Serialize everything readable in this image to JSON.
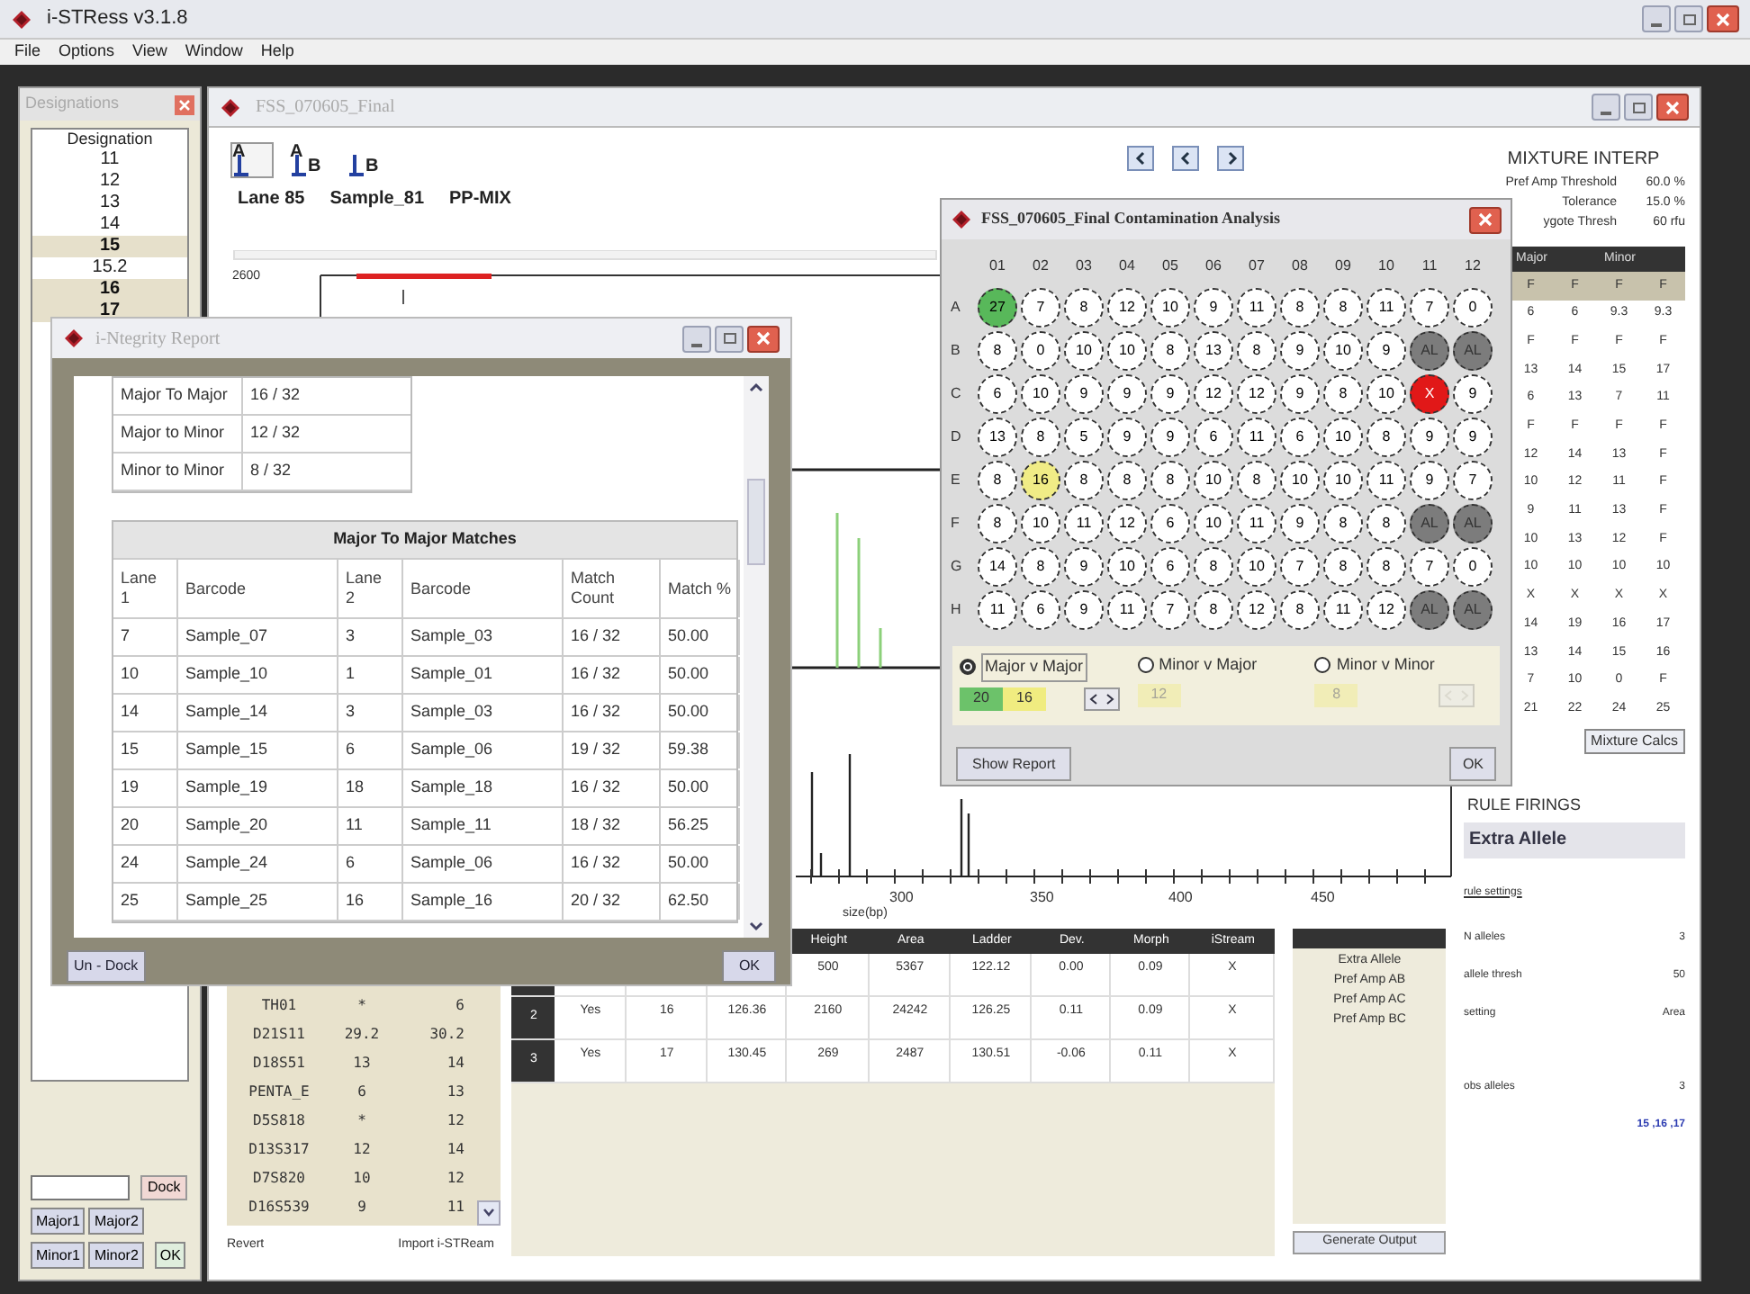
{
  "window": {
    "title": "i-STRess v3.1.8"
  },
  "menu": [
    "File",
    "Options",
    "View",
    "Window",
    "Help"
  ],
  "designations": {
    "title": "Designations",
    "header": "Designation",
    "items": [
      {
        "label": "11",
        "selected": false
      },
      {
        "label": "12",
        "selected": false
      },
      {
        "label": "13",
        "selected": false
      },
      {
        "label": "14",
        "selected": false
      },
      {
        "label": "15",
        "selected": true
      },
      {
        "label": "15.2",
        "selected": false
      },
      {
        "label": "16",
        "selected": true
      },
      {
        "label": "17",
        "selected": true
      }
    ],
    "dock_button": "Dock",
    "buttons": [
      [
        "Major1",
        "Major2"
      ],
      [
        "Minor1",
        "Minor2",
        "OK"
      ]
    ]
  },
  "main": {
    "title": "FSS_070605_Final",
    "view_buttons": [
      {
        "letters": [
          "A"
        ],
        "selected": true
      },
      {
        "letters": [
          "A",
          "B"
        ],
        "selected": false
      },
      {
        "letters": [
          "B"
        ],
        "selected": false
      }
    ],
    "nav_buttons": [
      {
        "kind": "prev"
      },
      {
        "kind": "prev"
      },
      {
        "kind": "next"
      }
    ],
    "lane": "Lane 85",
    "sample": "Sample_81",
    "kit": "PP-MIX",
    "chart": {
      "y_labels": [
        "2600"
      ],
      "x_labels": [
        "300",
        "350",
        "400",
        "450"
      ],
      "x_title": "size(bp)"
    },
    "loci": [
      {
        "name": "TH01",
        "a": "*",
        "b": "6"
      },
      {
        "name": "D21S11",
        "a": "29.2",
        "b": "30.2"
      },
      {
        "name": "D18S51",
        "a": "13",
        "b": "14"
      },
      {
        "name": "PENTA_E",
        "a": "6",
        "b": "13"
      },
      {
        "name": "D5S818",
        "a": "*",
        "b": "12"
      },
      {
        "name": "D13S317",
        "a": "12",
        "b": "14"
      },
      {
        "name": "D7S820",
        "a": "10",
        "b": "12"
      },
      {
        "name": "D16S539",
        "a": "9",
        "b": "11"
      }
    ],
    "revert": "Revert",
    "import": "Import i-STReam",
    "peak_columns": [
      "Height",
      "Area",
      "Ladder",
      "Dev.",
      "Morph",
      "iStream"
    ],
    "peak_rows": [
      {
        "cells": [
          "500",
          "5367",
          "122.12",
          "0.00",
          "0.09",
          "X"
        ]
      },
      {
        "label": "2",
        "cells": [
          "Yes",
          "16",
          "126.36",
          "2160",
          "24242",
          "126.25",
          "0.11",
          "0.09",
          "X"
        ]
      },
      {
        "label": "3",
        "cells": [
          "Yes",
          "17",
          "130.45",
          "269",
          "2487",
          "130.51",
          "-0.06",
          "0.11",
          "X"
        ]
      }
    ],
    "rules": [
      "Extra Allele",
      "Pref Amp AB",
      "Pref Amp AC",
      "Pref Amp BC"
    ],
    "generate_button": "Generate Output",
    "mixture": {
      "title": "MIXTURE INTERP",
      "settings": [
        {
          "label": "Pref Amp Threshold",
          "value": "60.0 %"
        },
        {
          "label": "Tolerance",
          "value": "15.0 %"
        },
        {
          "label": "ygote Thresh",
          "value": "60 rfu"
        }
      ],
      "groups": [
        "Major",
        "Minor"
      ],
      "rows": [
        [
          "F",
          "F",
          "F",
          "F"
        ],
        [
          "6",
          "6",
          "9.3",
          "9.3"
        ],
        [
          "F",
          "F",
          "F",
          "F"
        ],
        [
          "13",
          "14",
          "15",
          "17"
        ],
        [
          "6",
          "13",
          "7",
          "11"
        ],
        [
          "F",
          "F",
          "F",
          "F"
        ],
        [
          "12",
          "14",
          "13",
          "F"
        ],
        [
          "10",
          "12",
          "11",
          "F"
        ],
        [
          "9",
          "11",
          "13",
          "F"
        ],
        [
          "10",
          "13",
          "12",
          "F"
        ],
        [
          "10",
          "10",
          "10",
          "10"
        ],
        [
          "X",
          "X",
          "X",
          "X"
        ],
        [
          "14",
          "19",
          "16",
          "17"
        ],
        [
          "13",
          "14",
          "15",
          "16"
        ],
        [
          "7",
          "10",
          "0",
          "F"
        ],
        [
          "21",
          "22",
          "24",
          "25"
        ]
      ],
      "calcs_button": "Mixture Calcs"
    },
    "rule_firings": {
      "title": "RULE FIRINGS",
      "rule": "Extra Allele",
      "settings_link": "rule settings",
      "params": [
        {
          "label": "N alleles",
          "value": "3"
        },
        {
          "label": "allele thresh",
          "value": "50"
        },
        {
          "label": "setting",
          "value": "Area"
        },
        {
          "label": "obs alleles",
          "value": "3"
        }
      ],
      "alleles": "15 ,16 ,17"
    }
  },
  "report": {
    "title": "i-Ntegrity Report",
    "summary": [
      {
        "label": "Major To Major",
        "value": "16 / 32"
      },
      {
        "label": "Major to Minor",
        "value": "12 / 32"
      },
      {
        "label": "Minor to Minor",
        "value": "8 / 32"
      }
    ],
    "table_title": "Major To Major Matches",
    "columns": [
      "Lane 1",
      "Barcode",
      "Lane 2",
      "Barcode",
      "Match Count",
      "Match %"
    ],
    "rows": [
      [
        "7",
        "Sample_07",
        "3",
        "Sample_03",
        "16 / 32",
        "50.00"
      ],
      [
        "10",
        "Sample_10",
        "1",
        "Sample_01",
        "16 / 32",
        "50.00"
      ],
      [
        "14",
        "Sample_14",
        "3",
        "Sample_03",
        "16 / 32",
        "50.00"
      ],
      [
        "15",
        "Sample_15",
        "6",
        "Sample_06",
        "19 / 32",
        "59.38"
      ],
      [
        "19",
        "Sample_19",
        "18",
        "Sample_18",
        "16 / 32",
        "50.00"
      ],
      [
        "20",
        "Sample_20",
        "11",
        "Sample_11",
        "18 / 32",
        "56.25"
      ],
      [
        "24",
        "Sample_24",
        "6",
        "Sample_06",
        "16 / 32",
        "50.00"
      ],
      [
        "25",
        "Sample_25",
        "16",
        "Sample_16",
        "20 / 32",
        "62.50"
      ]
    ],
    "undock_button": "Un - Dock",
    "ok_button": "OK"
  },
  "contamination": {
    "title": "FSS_070605_Final Contamination Analysis",
    "columns": [
      "01",
      "02",
      "03",
      "04",
      "05",
      "06",
      "07",
      "08",
      "09",
      "10",
      "11",
      "12"
    ],
    "rows": [
      {
        "label": "A",
        "wells": [
          {
            "text": "27",
            "kind": "major"
          },
          {
            "text": "7",
            "kind": "sample"
          },
          {
            "text": "8",
            "kind": "sample"
          },
          {
            "text": "12",
            "kind": "sample"
          },
          {
            "text": "10",
            "kind": "sample"
          },
          {
            "text": "9",
            "kind": "sample"
          },
          {
            "text": "11",
            "kind": "sample"
          },
          {
            "text": "8",
            "kind": "sample"
          },
          {
            "text": "8",
            "kind": "sample"
          },
          {
            "text": "11",
            "kind": "sample"
          },
          {
            "text": "7",
            "kind": "sample"
          },
          {
            "text": "0",
            "kind": "sample"
          }
        ]
      },
      {
        "label": "B",
        "wells": [
          {
            "text": "8",
            "kind": "sample"
          },
          {
            "text": "0",
            "kind": "sample"
          },
          {
            "text": "10",
            "kind": "sample"
          },
          {
            "text": "10",
            "kind": "sample"
          },
          {
            "text": "8",
            "kind": "sample"
          },
          {
            "text": "13",
            "kind": "sample"
          },
          {
            "text": "8",
            "kind": "sample"
          },
          {
            "text": "9",
            "kind": "sample"
          },
          {
            "text": "10",
            "kind": "sample"
          },
          {
            "text": "9",
            "kind": "sample"
          },
          {
            "text": "AL",
            "kind": "ladder"
          },
          {
            "text": "AL",
            "kind": "ladder"
          }
        ]
      },
      {
        "label": "C",
        "wells": [
          {
            "text": "6",
            "kind": "sample"
          },
          {
            "text": "10",
            "kind": "sample"
          },
          {
            "text": "9",
            "kind": "sample"
          },
          {
            "text": "9",
            "kind": "sample"
          },
          {
            "text": "9",
            "kind": "sample"
          },
          {
            "text": "12",
            "kind": "sample"
          },
          {
            "text": "12",
            "kind": "sample"
          },
          {
            "text": "9",
            "kind": "sample"
          },
          {
            "text": "8",
            "kind": "sample"
          },
          {
            "text": "10",
            "kind": "sample"
          },
          {
            "text": "X",
            "kind": "flagged"
          },
          {
            "text": "9",
            "kind": "sample"
          }
        ]
      },
      {
        "label": "D",
        "wells": [
          {
            "text": "13",
            "kind": "sample"
          },
          {
            "text": "8",
            "kind": "sample"
          },
          {
            "text": "5",
            "kind": "sample"
          },
          {
            "text": "9",
            "kind": "sample"
          },
          {
            "text": "9",
            "kind": "sample"
          },
          {
            "text": "6",
            "kind": "sample"
          },
          {
            "text": "11",
            "kind": "sample"
          },
          {
            "text": "6",
            "kind": "sample"
          },
          {
            "text": "10",
            "kind": "sample"
          },
          {
            "text": "8",
            "kind": "sample"
          },
          {
            "text": "9",
            "kind": "sample"
          },
          {
            "text": "9",
            "kind": "sample"
          }
        ]
      },
      {
        "label": "E",
        "wells": [
          {
            "text": "8",
            "kind": "sample"
          },
          {
            "text": "16",
            "kind": "minor"
          },
          {
            "text": "8",
            "kind": "sample"
          },
          {
            "text": "8",
            "kind": "sample"
          },
          {
            "text": "8",
            "kind": "sample"
          },
          {
            "text": "10",
            "kind": "sample"
          },
          {
            "text": "8",
            "kind": "sample"
          },
          {
            "text": "10",
            "kind": "sample"
          },
          {
            "text": "10",
            "kind": "sample"
          },
          {
            "text": "11",
            "kind": "sample"
          },
          {
            "text": "9",
            "kind": "sample"
          },
          {
            "text": "7",
            "kind": "sample"
          }
        ]
      },
      {
        "label": "F",
        "wells": [
          {
            "text": "8",
            "kind": "sample"
          },
          {
            "text": "10",
            "kind": "sample"
          },
          {
            "text": "11",
            "kind": "sample"
          },
          {
            "text": "12",
            "kind": "sample"
          },
          {
            "text": "6",
            "kind": "sample"
          },
          {
            "text": "10",
            "kind": "sample"
          },
          {
            "text": "11",
            "kind": "sample"
          },
          {
            "text": "9",
            "kind": "sample"
          },
          {
            "text": "8",
            "kind": "sample"
          },
          {
            "text": "8",
            "kind": "sample"
          },
          {
            "text": "AL",
            "kind": "ladder"
          },
          {
            "text": "AL",
            "kind": "ladder"
          }
        ]
      },
      {
        "label": "G",
        "wells": [
          {
            "text": "14",
            "kind": "sample"
          },
          {
            "text": "8",
            "kind": "sample"
          },
          {
            "text": "9",
            "kind": "sample"
          },
          {
            "text": "10",
            "kind": "sample"
          },
          {
            "text": "6",
            "kind": "sample"
          },
          {
            "text": "8",
            "kind": "sample"
          },
          {
            "text": "10",
            "kind": "sample"
          },
          {
            "text": "7",
            "kind": "sample"
          },
          {
            "text": "8",
            "kind": "sample"
          },
          {
            "text": "8",
            "kind": "sample"
          },
          {
            "text": "7",
            "kind": "sample"
          },
          {
            "text": "0",
            "kind": "sample"
          }
        ]
      },
      {
        "label": "H",
        "wells": [
          {
            "text": "11",
            "kind": "sample"
          },
          {
            "text": "6",
            "kind": "sample"
          },
          {
            "text": "9",
            "kind": "sample"
          },
          {
            "text": "11",
            "kind": "sample"
          },
          {
            "text": "7",
            "kind": "sample"
          },
          {
            "text": "8",
            "kind": "sample"
          },
          {
            "text": "12",
            "kind": "sample"
          },
          {
            "text": "8",
            "kind": "sample"
          },
          {
            "text": "11",
            "kind": "sample"
          },
          {
            "text": "12",
            "kind": "sample"
          },
          {
            "text": "AL",
            "kind": "ladder"
          },
          {
            "text": "AL",
            "kind": "ladder"
          }
        ]
      }
    ],
    "options": [
      {
        "label": "Major v Major",
        "selected": true,
        "counts": [
          {
            "text": "20",
            "kind": "major"
          },
          {
            "text": "16",
            "kind": "minor"
          }
        ],
        "stepper": true
      },
      {
        "label": "Minor v Major",
        "selected": false,
        "counts": [
          {
            "text": "12",
            "kind": "minor"
          }
        ],
        "stepper": false
      },
      {
        "label": "Minor v Minor",
        "selected": false,
        "counts": [
          {
            "text": "8",
            "kind": "minor"
          }
        ],
        "stepper": true
      }
    ],
    "show_report_button": "Show Report",
    "ok_button": "OK"
  }
}
